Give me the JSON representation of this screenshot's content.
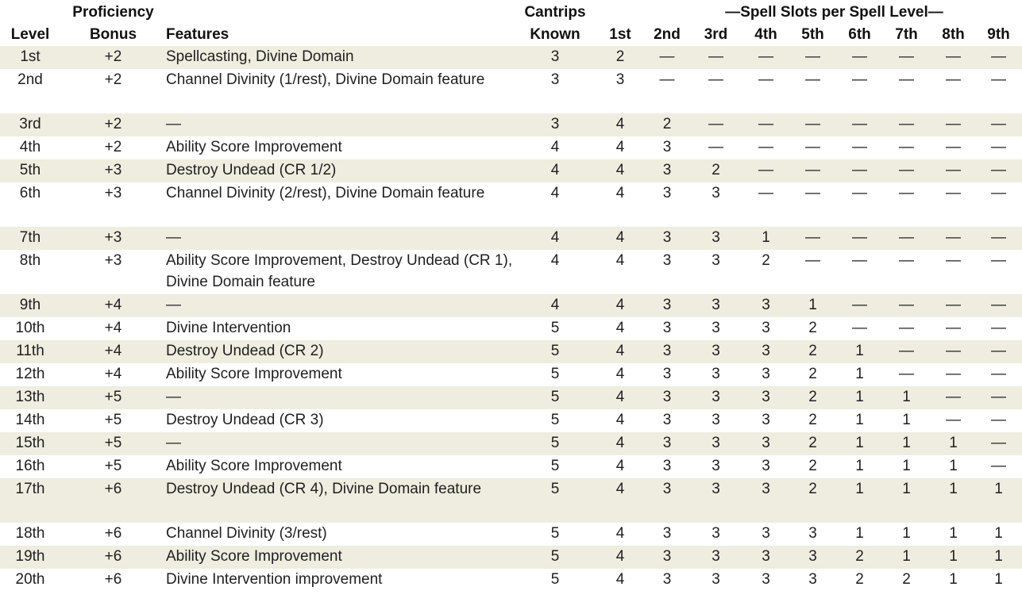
{
  "header": {
    "level": "Level",
    "proficiency_top": "Proficiency",
    "proficiency_bottom": "Bonus",
    "features": "Features",
    "cantrips_top": "Cantrips",
    "cantrips_bottom": "Known",
    "slots_title": "—Spell Slots per Spell Level—",
    "slot_levels": [
      "1st",
      "2nd",
      "3rd",
      "4th",
      "5th",
      "6th",
      "7th",
      "8th",
      "9th"
    ]
  },
  "rows": [
    {
      "level": "1st",
      "bonus": "+2",
      "features": "Spellcasting, Divine Domain",
      "cantrips": "3",
      "slots": [
        "2",
        "—",
        "—",
        "—",
        "—",
        "—",
        "—",
        "—",
        "—"
      ]
    },
    {
      "level": "2nd",
      "bonus": "+2",
      "features": "Channel Divinity (1/rest), Divine Domain feature",
      "cantrips": "3",
      "slots": [
        "3",
        "—",
        "—",
        "—",
        "—",
        "—",
        "—",
        "—",
        "—"
      ]
    },
    {
      "level": "3rd",
      "bonus": "+2",
      "features": "—",
      "cantrips": "3",
      "slots": [
        "4",
        "2",
        "—",
        "—",
        "—",
        "—",
        "—",
        "—",
        "—"
      ]
    },
    {
      "level": "4th",
      "bonus": "+2",
      "features": "Ability Score Improvement",
      "cantrips": "4",
      "slots": [
        "4",
        "3",
        "—",
        "—",
        "—",
        "—",
        "—",
        "—",
        "—"
      ]
    },
    {
      "level": "5th",
      "bonus": "+3",
      "features": "Destroy Undead (CR 1/2)",
      "cantrips": "4",
      "slots": [
        "4",
        "3",
        "2",
        "—",
        "—",
        "—",
        "—",
        "—",
        "—"
      ]
    },
    {
      "level": "6th",
      "bonus": "+3",
      "features": "Channel Divinity (2/rest), Divine Domain feature",
      "cantrips": "4",
      "slots": [
        "4",
        "3",
        "3",
        "—",
        "—",
        "—",
        "—",
        "—",
        "—"
      ]
    },
    {
      "level": "7th",
      "bonus": "+3",
      "features": "—",
      "cantrips": "4",
      "slots": [
        "4",
        "3",
        "3",
        "1",
        "—",
        "—",
        "—",
        "—",
        "—"
      ]
    },
    {
      "level": "8th",
      "bonus": "+3",
      "features": "Ability Score Improvement, Destroy Undead (CR 1), Divine Domain feature",
      "cantrips": "4",
      "slots": [
        "4",
        "3",
        "3",
        "2",
        "—",
        "—",
        "—",
        "—",
        "—"
      ]
    },
    {
      "level": "9th",
      "bonus": "+4",
      "features": "—",
      "cantrips": "4",
      "slots": [
        "4",
        "3",
        "3",
        "3",
        "1",
        "—",
        "—",
        "—",
        "—"
      ]
    },
    {
      "level": "10th",
      "bonus": "+4",
      "features": "Divine Intervention",
      "cantrips": "5",
      "slots": [
        "4",
        "3",
        "3",
        "3",
        "2",
        "—",
        "—",
        "—",
        "—"
      ]
    },
    {
      "level": "11th",
      "bonus": "+4",
      "features": "Destroy Undead (CR 2)",
      "cantrips": "5",
      "slots": [
        "4",
        "3",
        "3",
        "3",
        "2",
        "1",
        "—",
        "—",
        "—"
      ]
    },
    {
      "level": "12th",
      "bonus": "+4",
      "features": "Ability Score Improvement",
      "cantrips": "5",
      "slots": [
        "4",
        "3",
        "3",
        "3",
        "2",
        "1",
        "—",
        "—",
        "—"
      ]
    },
    {
      "level": "13th",
      "bonus": "+5",
      "features": "—",
      "cantrips": "5",
      "slots": [
        "4",
        "3",
        "3",
        "3",
        "2",
        "1",
        "1",
        "—",
        "—"
      ]
    },
    {
      "level": "14th",
      "bonus": "+5",
      "features": "Destroy Undead (CR 3)",
      "cantrips": "5",
      "slots": [
        "4",
        "3",
        "3",
        "3",
        "2",
        "1",
        "1",
        "—",
        "—"
      ]
    },
    {
      "level": "15th",
      "bonus": "+5",
      "features": "—",
      "cantrips": "5",
      "slots": [
        "4",
        "3",
        "3",
        "3",
        "2",
        "1",
        "1",
        "1",
        "—"
      ]
    },
    {
      "level": "16th",
      "bonus": "+5",
      "features": "Ability Score Improvement",
      "cantrips": "5",
      "slots": [
        "4",
        "3",
        "3",
        "3",
        "2",
        "1",
        "1",
        "1",
        "—"
      ]
    },
    {
      "level": "17th",
      "bonus": "+6",
      "features": "Destroy Undead (CR 4), Divine Domain feature",
      "cantrips": "5",
      "slots": [
        "4",
        "3",
        "3",
        "3",
        "2",
        "1",
        "1",
        "1",
        "1"
      ]
    },
    {
      "level": "18th",
      "bonus": "+6",
      "features": "Channel Divinity (3/rest)",
      "cantrips": "5",
      "slots": [
        "4",
        "3",
        "3",
        "3",
        "3",
        "1",
        "1",
        "1",
        "1"
      ]
    },
    {
      "level": "19th",
      "bonus": "+6",
      "features": "Ability Score Improvement",
      "cantrips": "5",
      "slots": [
        "4",
        "3",
        "3",
        "3",
        "3",
        "2",
        "1",
        "1",
        "1"
      ]
    },
    {
      "level": "20th",
      "bonus": "+6",
      "features": "Divine Intervention improvement",
      "cantrips": "5",
      "slots": [
        "4",
        "3",
        "3",
        "3",
        "3",
        "2",
        "2",
        "1",
        "1"
      ]
    }
  ]
}
